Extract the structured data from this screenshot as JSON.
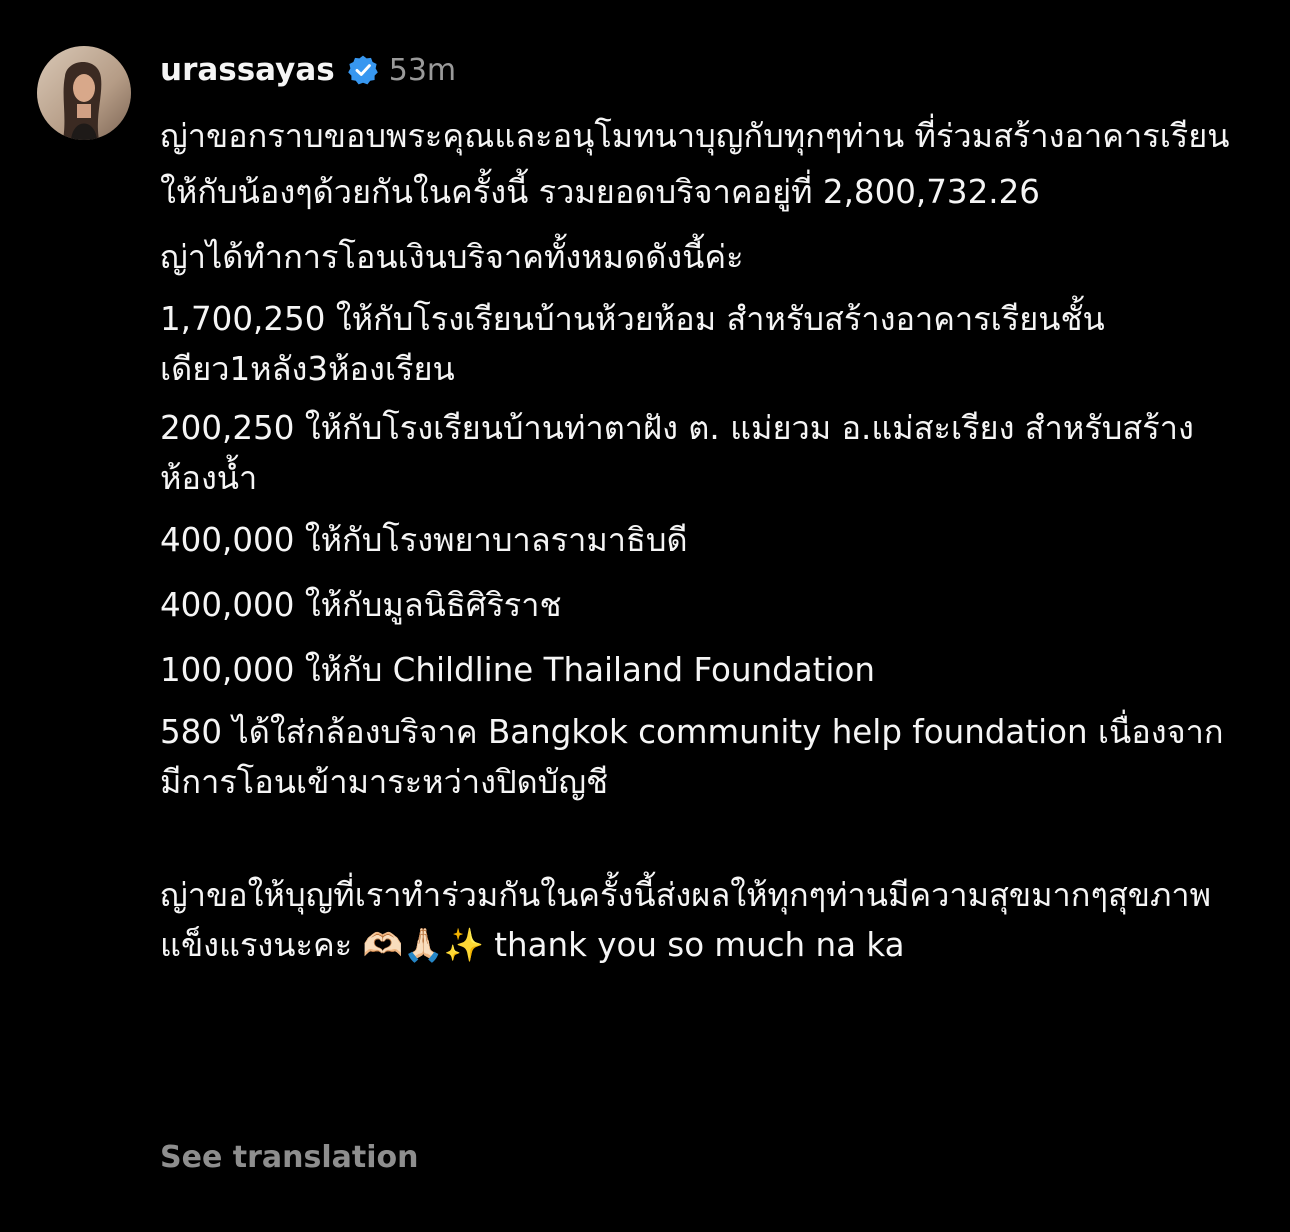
{
  "post": {
    "username": "urassayas",
    "verified": true,
    "time_ago": "53m",
    "avatar_icon": "profile-photo-avatar",
    "verified_icon": "verified-badge-icon",
    "caption_paragraphs": [
      "ญ่าขอกราบขอบพระคุณและอนุโมทนาบุญกับทุกๆท่าน ที่ร่วมสร้างอาคารเรียนให้กับน้องๆด้วยกันในครั้งนี้ รวมยอดบริจาคอยู่ที่ 2,800,732.26",
      "ญ่าได้ทำการโอนเงินบริจาคทั้งหมดดังนี้ค่ะ",
      "1,700,250 ให้กับโรงเรียนบ้านห้วยห้อม สำหรับสร้างอาคารเรียนชั้นเดียว1หลัง3ห้องเรียน",
      "200,250 ให้กับโรงเรียนบ้านท่าตาฝัง ต. แม่ยวม อ.แม่สะเรียง สำหรับสร้างห้องน้ำ",
      "400,000 ให้กับโรงพยาบาลรามาธิบดี",
      "400,000 ให้กับมูลนิธิศิริราช",
      "100,000 ให้กับ Childline Thailand Foundation",
      "580 ได้ใส่กล้องบริจาค Bangkok community help foundation เนื่องจากมีการโอนเข้ามาระหว่างปิดบัญชี",
      "ญ่าขอให้บุญที่เราทำร่วมกันในครั้งนี้ส่งผลให้ทุกๆท่านมีความสุขมากๆสุขภาพแข็งแรงนะคะ 🫶🏻🙏🏻✨ thank you so much na ka"
    ],
    "see_translation": "See translation"
  },
  "colors": {
    "background": "#000000",
    "text": "#f5f5f5",
    "muted": "#9a9a9a",
    "verified_blue": "#3797f0"
  }
}
